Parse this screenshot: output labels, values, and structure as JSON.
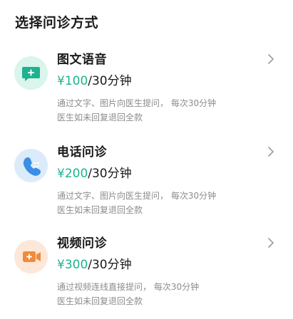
{
  "page": {
    "title": "选择问诊方式"
  },
  "options": [
    {
      "title": "图文语音",
      "price": "¥100",
      "unit": "/30分钟",
      "desc_line1": "通过文字、图片向医生提问， 每次30分钟",
      "desc_line2": "医生如未回复退回全款",
      "icon": "chat-message-icon"
    },
    {
      "title": "电话问诊",
      "price": "¥200",
      "unit": "/30分钟",
      "desc_line1": "通过文字、图片向医生提问， 每次30分钟",
      "desc_line2": "医生如未回复退回全款",
      "icon": "phone-icon"
    },
    {
      "title": "视频问诊",
      "price": "¥300",
      "unit": "/30分钟",
      "desc_line1": "通过视频连线直接提问， 每次30分钟",
      "desc_line2": "医生如未回复退回全款",
      "icon": "video-camera-icon"
    }
  ],
  "colors": {
    "price": "#1db38f",
    "chat_icon": "#1db38f",
    "phone_icon": "#3a8ee6",
    "video_icon": "#f28a3a"
  }
}
